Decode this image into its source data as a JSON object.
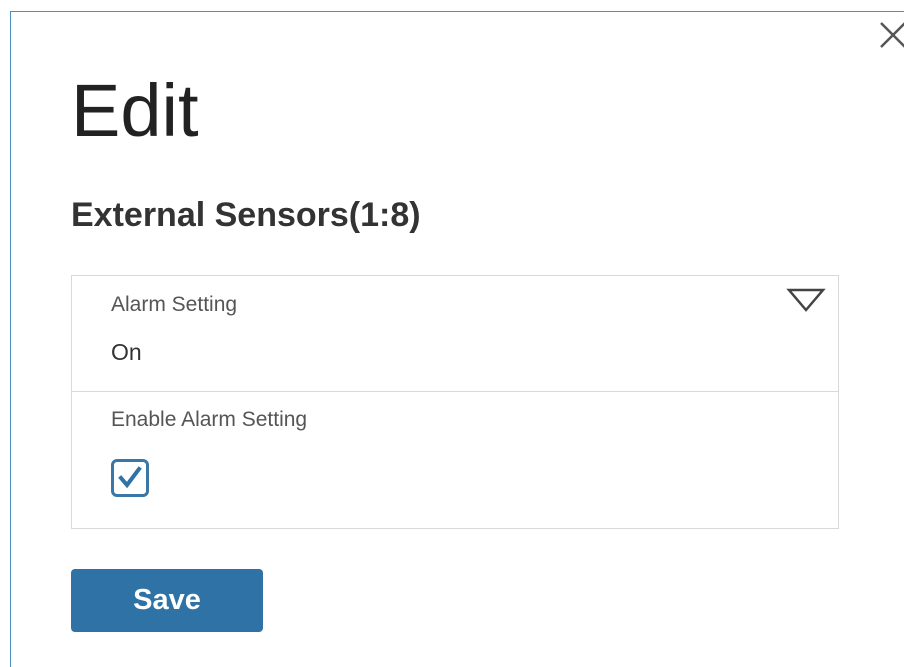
{
  "dialog": {
    "title": "Edit",
    "subtitle": "External Sensors(1:8)",
    "close_icon": "close-icon"
  },
  "form": {
    "alarm_setting": {
      "label": "Alarm Setting",
      "value": "On",
      "icon": "dropdown-triangle-icon"
    },
    "enable_alarm_setting": {
      "label": "Enable Alarm Setting",
      "checked": true,
      "icon": "checkmark-icon"
    }
  },
  "actions": {
    "save_label": "Save"
  },
  "colors": {
    "accent": "#2f73a6",
    "checkbox_border": "#3a77a6",
    "dialog_border": "#4a90c8"
  }
}
